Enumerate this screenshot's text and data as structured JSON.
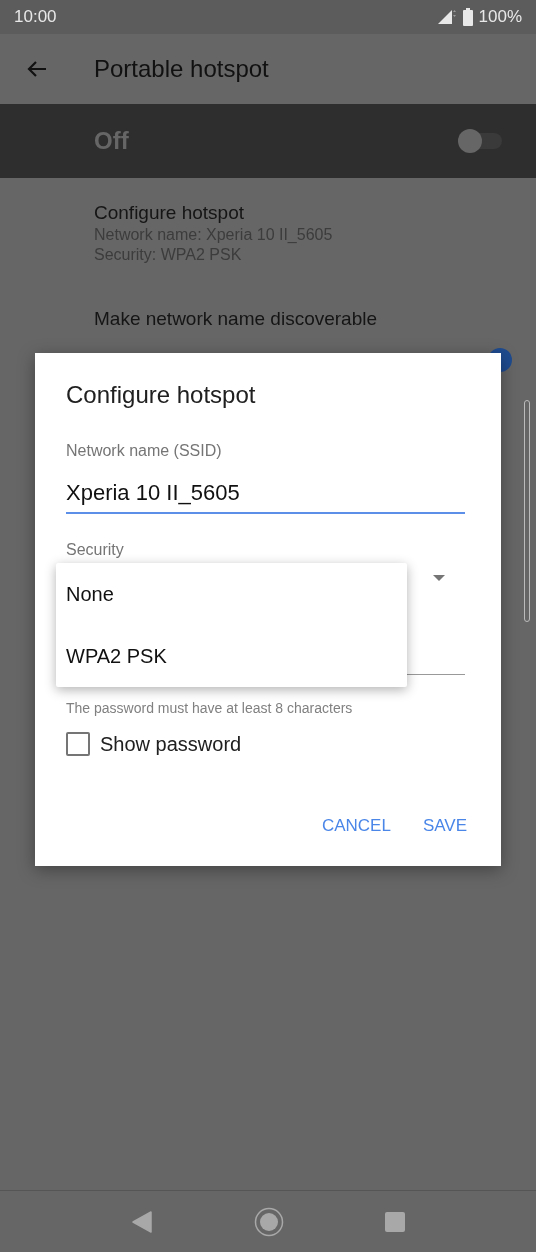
{
  "status_bar": {
    "time": "10:00",
    "battery": "100%"
  },
  "app_bar": {
    "title": "Portable hotspot"
  },
  "master_switch": {
    "label": "Off",
    "on": false
  },
  "settings": [
    {
      "kind": "text",
      "title": "Configure hotspot",
      "lines": [
        "Network name: Xperia 10 II_5605",
        "Security: WPA2 PSK"
      ]
    },
    {
      "kind": "switch",
      "title": "Make network name discoverable",
      "on": true
    }
  ],
  "dialog": {
    "title": "Configure hotspot",
    "ssid": {
      "label": "Network name (SSID)",
      "value": "Xperia 10 II_5605",
      "focused": true
    },
    "security": {
      "label": "Security"
    },
    "password": {
      "hint": "The password must have at least 8 characters"
    },
    "show_password": {
      "label": "Show password",
      "checked": false
    },
    "buttons": [
      "CANCEL",
      "SAVE"
    ]
  },
  "dropdown_menu": {
    "options": [
      {
        "label": "None",
        "selected": false
      },
      {
        "label": "WPA2 PSK",
        "selected": false
      }
    ]
  }
}
